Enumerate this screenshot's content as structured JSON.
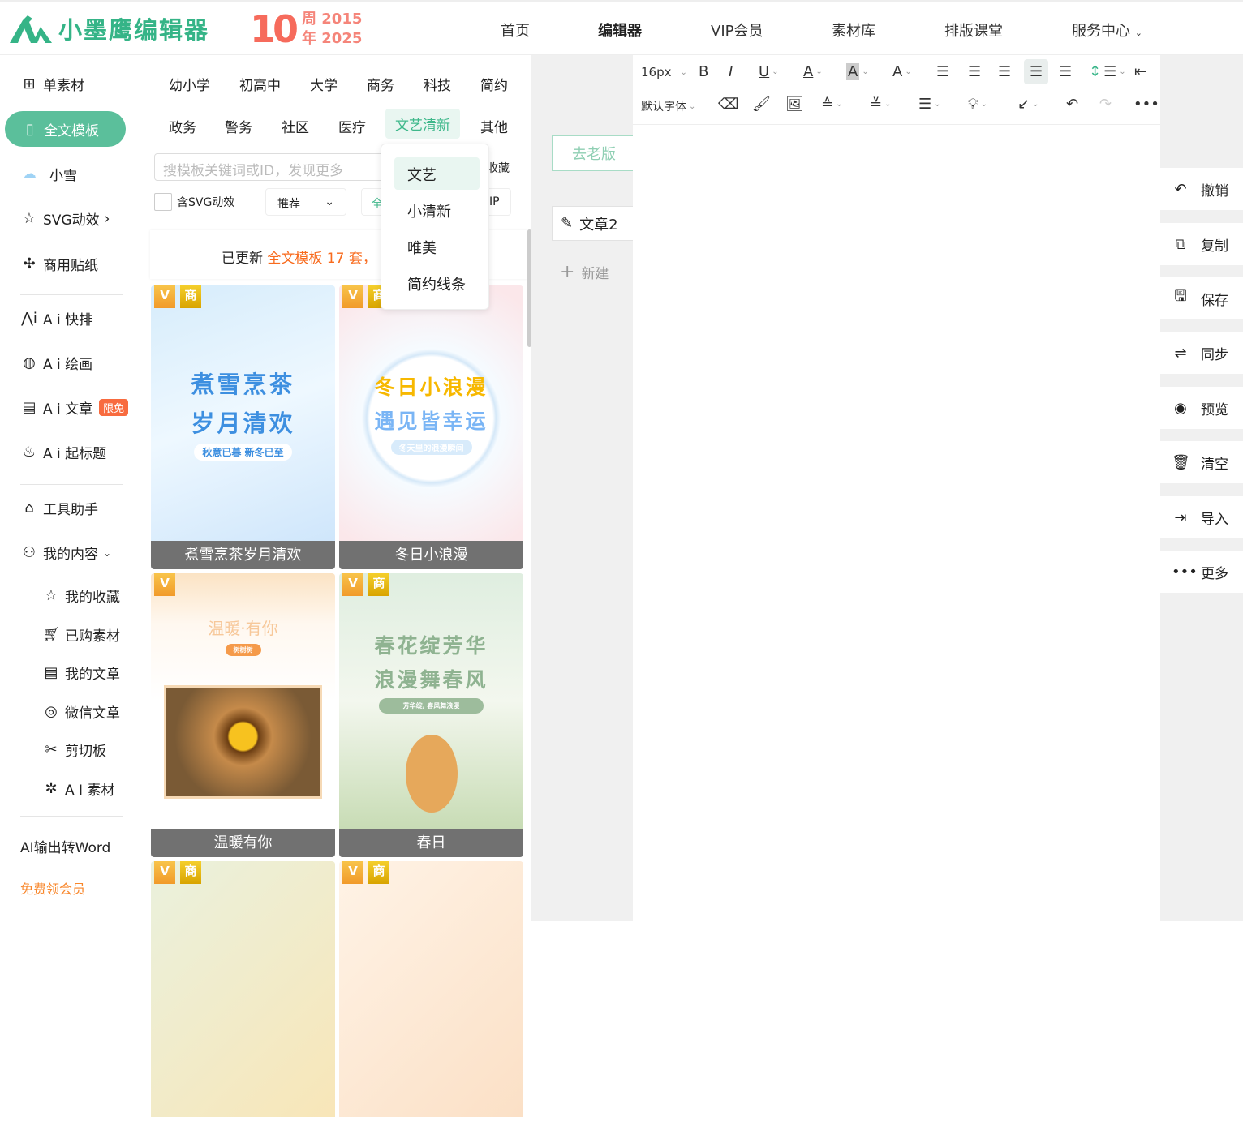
{
  "header": {
    "logo_text": "小墨鹰编辑器",
    "anniversary": {
      "number": "10",
      "line1": "周 2015",
      "line2": "年 2025"
    },
    "nav": [
      "首页",
      "编辑器",
      "VIP会员",
      "素材库",
      "排版课堂",
      "服务中心"
    ],
    "active_nav": "编辑器"
  },
  "sidebar": {
    "items": [
      {
        "label": "单素材",
        "icon": "grid-icon"
      },
      {
        "label": "全文模板",
        "icon": "template-icon",
        "active": true
      },
      {
        "label": "小雪",
        "icon": "snow-cloud-icon"
      },
      {
        "label": "SVG动效",
        "icon": "star-svg-icon"
      },
      {
        "label": "商用贴纸",
        "icon": "puzzle-icon"
      },
      {
        "label": "A i 快排",
        "icon": "ai-icon"
      },
      {
        "label": "A i 绘画",
        "icon": "palette-icon"
      },
      {
        "label": "A i 文章",
        "icon": "doc-icon",
        "badge": "限免"
      },
      {
        "label": "A i 起标题",
        "icon": "flame-icon"
      },
      {
        "label": "工具助手",
        "icon": "eraser-icon"
      },
      {
        "label": "我的内容",
        "icon": "user-icon"
      },
      {
        "label": "我的收藏",
        "icon": "star-icon"
      },
      {
        "label": "已购素材",
        "icon": "cart-icon"
      },
      {
        "label": "我的文章",
        "icon": "article-icon"
      },
      {
        "label": "微信文章",
        "icon": "wechat-icon"
      },
      {
        "label": "剪切板",
        "icon": "scissors-icon"
      },
      {
        "label": "A I 素材",
        "icon": "sparkle-icon"
      },
      {
        "label": "AI输出转Word"
      },
      {
        "label": "免费领会员"
      }
    ]
  },
  "templates": {
    "categories_row1": [
      "幼小学",
      "初高中",
      "大学",
      "商务",
      "科技",
      "简约"
    ],
    "categories_row2": [
      "政务",
      "警务",
      "社区",
      "医疗",
      "文艺清新",
      "其他"
    ],
    "search_placeholder": "搜模板关键词或ID，发现更多",
    "fav_partial": "收藏",
    "svg_checkbox": "含SVG动效",
    "sort": "推荐",
    "all_partial": "全",
    "vip_partial": "IP",
    "notice": {
      "prefix": "已更新",
      "highlight": "全文模板 17 套",
      "suffix": "，"
    },
    "tags": {
      "v": "V",
      "shang": "商"
    },
    "cards": [
      {
        "caption": "煮雪烹茶岁月清欢",
        "title1": "煮雪烹茶",
        "title2": "岁月清欢",
        "pill": "秋意已暮 新冬已至"
      },
      {
        "caption": "冬日小浪漫",
        "title1": "冬日小浪漫",
        "title2": "遇见皆幸运",
        "pill": "冬天里的浪漫瞬间"
      },
      {
        "caption": "温暖有你",
        "title1": "温暖·有你",
        "title2": "",
        "pill": "树树树"
      },
      {
        "caption": "春日",
        "title1": "春花绽芳华",
        "title2": "浪漫舞春风",
        "pill": "芳华绽, 春风舞浪漫"
      },
      {
        "caption": ""
      },
      {
        "caption": ""
      }
    ]
  },
  "dropdown": {
    "options": [
      "文艺",
      "小清新",
      "唯美",
      "简约线条"
    ],
    "selected": "文艺"
  },
  "articles": {
    "old_version": "去老版",
    "current": "文章2",
    "new": "新建"
  },
  "toolbar": {
    "font_size": "16px",
    "font_family": "默认字体"
  },
  "right_panel": [
    {
      "label": "撤销",
      "icon": "undo-icon"
    },
    {
      "label": "复制",
      "icon": "copy-icon"
    },
    {
      "label": "保存",
      "icon": "save-icon"
    },
    {
      "label": "同步",
      "icon": "sync-icon"
    },
    {
      "label": "预览",
      "icon": "eye-icon"
    },
    {
      "label": "清空",
      "icon": "trash-icon"
    },
    {
      "label": "导入",
      "icon": "import-icon"
    },
    {
      "label": "更多",
      "icon": "more-icon"
    }
  ],
  "colors": {
    "brand": "#35b487",
    "accent": "#5bbf9b",
    "orange": "#f86b1e"
  }
}
